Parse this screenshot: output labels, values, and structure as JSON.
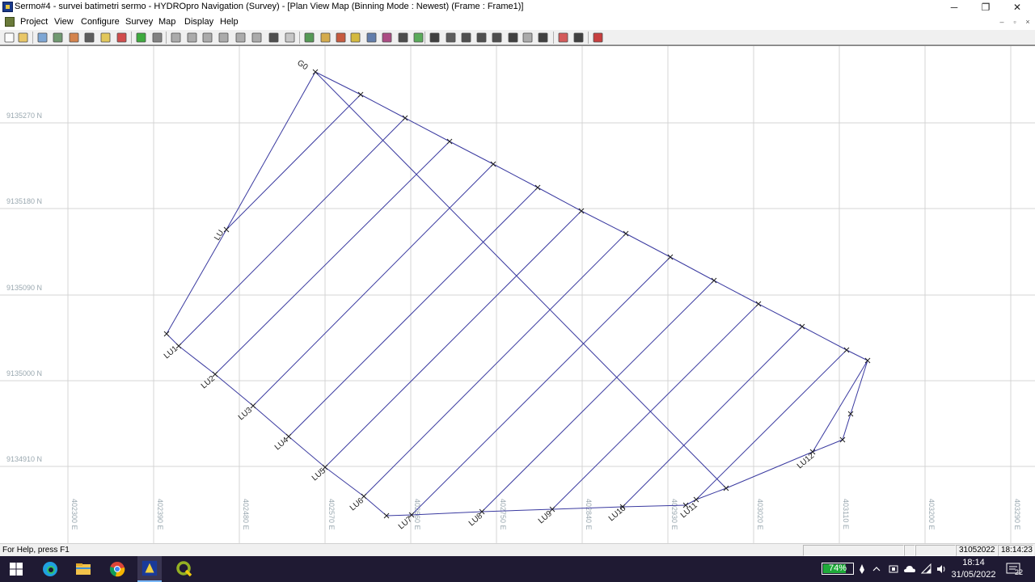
{
  "window": {
    "title": "Sermo#4 - survei batimetri sermo - HYDROpro Navigation (Survey) - [Plan View Map (Binning Mode : Newest)  (Frame : Frame1)]",
    "controls": {
      "minimize": "─",
      "restore": "❐",
      "close": "✕"
    }
  },
  "menu": {
    "items": [
      "Project",
      "View",
      "Configure",
      "Survey",
      "Map",
      "Display",
      "Help"
    ],
    "mdi": {
      "minimize": "‒",
      "restore": "▫",
      "close": "×"
    }
  },
  "toolbar": {
    "icons": [
      "new-icon",
      "open-icon",
      "project-icon",
      "template-icon",
      "device-icon",
      "vessel-icon",
      "database-icon",
      "mark-icon",
      "online-icon",
      "record-icon",
      "edit-line-icon",
      "draw-line-icon",
      "draw-polyline-icon",
      "offset-icon",
      "split-icon",
      "extend-icon",
      "pen-icon",
      "copy-icon",
      "layers-icon",
      "layer-add-icon",
      "waypoint-icon",
      "list-icon",
      "grid-icon",
      "chart-icon",
      "area-icon",
      "tide-icon",
      "pointer-icon",
      "pan-icon",
      "zoom-in-icon",
      "zoom-out-icon",
      "zoom-fit-icon",
      "track-icon",
      "next-icon",
      "measure-icon",
      "palette-icon",
      "crosshair-icon",
      "profile-icon"
    ]
  },
  "map": {
    "northing_labels": [
      "9135270  N",
      "9135180  N",
      "9135090  N",
      "9135000  N",
      "9134910  N"
    ],
    "easting_labels": [
      "402300  E",
      "402390  E",
      "402480  E",
      "402570  E",
      "402660  E",
      "402750  E",
      "402840  E",
      "402930  E",
      "403020  E",
      "403110  E",
      "403200  E",
      "403290  E"
    ],
    "line_labels": [
      "G0",
      "LU",
      "LU1",
      "LU2",
      "LU3",
      "LU4",
      "LU5",
      "LU6",
      "LU7",
      "LU8",
      "LU9",
      "LU10",
      "LU11",
      "LU12"
    ],
    "grid_color": "#d4d4d4",
    "line_color": "#3a3aa0",
    "label_color": "#9aa8b0"
  },
  "status": {
    "help": "For Help, press F1",
    "date": "31052022",
    "time": "18:14:23"
  },
  "taskbar": {
    "battery": "74%",
    "clock_time": "18:14",
    "clock_date": "31/05/2022",
    "notifications": "22"
  }
}
